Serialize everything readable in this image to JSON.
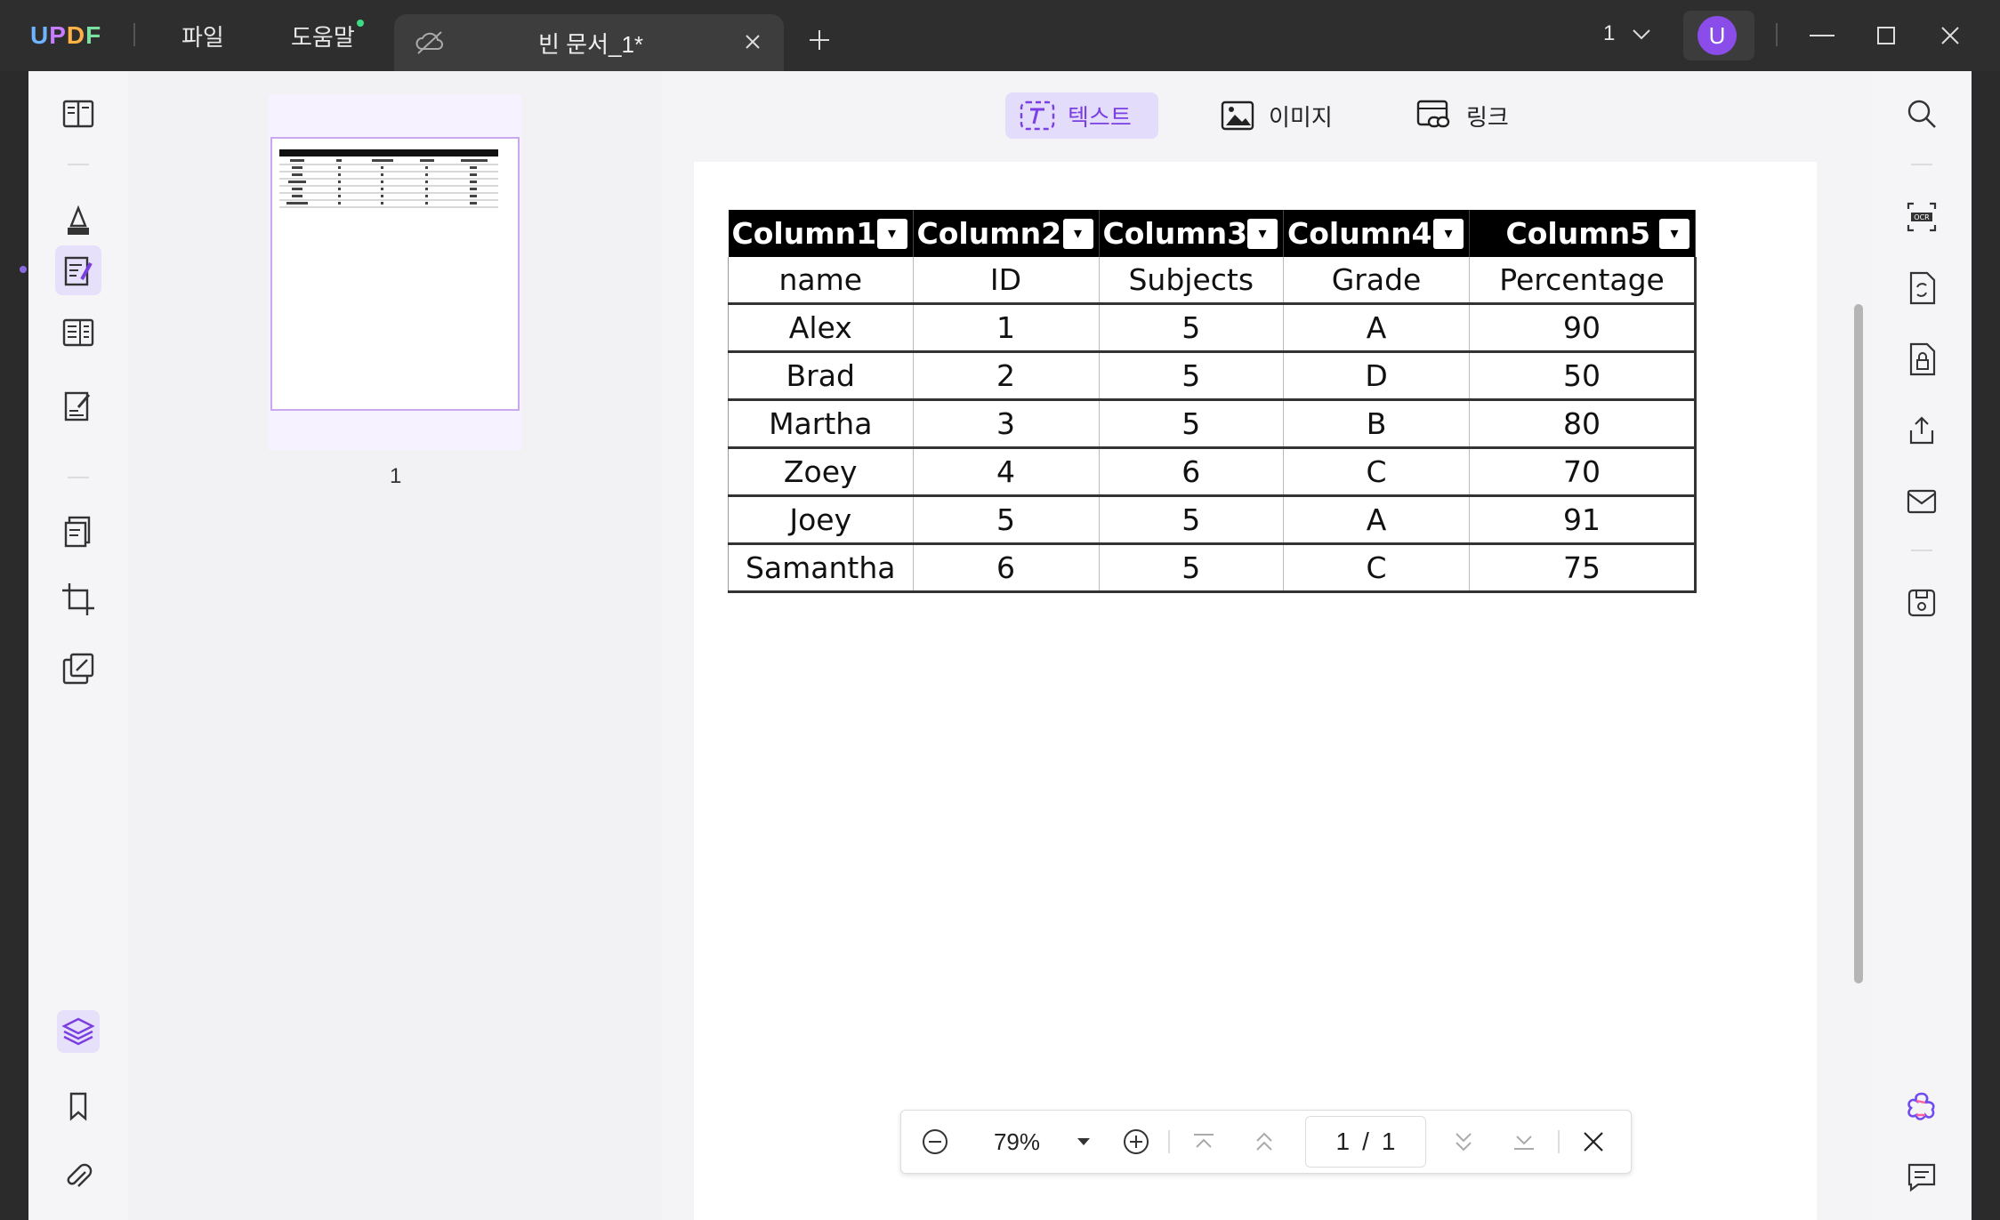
{
  "titlebar": {
    "app_logo": "UPDF",
    "menu": [
      "파일",
      "도움말"
    ],
    "tab_title": "빈 문서_1*",
    "page_selector": "1",
    "avatar_letter": "U"
  },
  "edit_toolbar": {
    "text_label": "텍스트",
    "image_label": "이미지",
    "link_label": "링크"
  },
  "thumbnail": {
    "page_number": "1"
  },
  "table": {
    "headers": [
      "Column1",
      "Column2",
      "Column3",
      "Column4",
      "Column5"
    ],
    "rows": [
      [
        "name",
        "ID",
        "Subjects",
        "Grade",
        "Percentage"
      ],
      [
        "Alex",
        "1",
        "5",
        "A",
        "90"
      ],
      [
        "Brad",
        "2",
        "5",
        "D",
        "50"
      ],
      [
        "Martha",
        "3",
        "5",
        "B",
        "80"
      ],
      [
        "Zoey",
        "4",
        "6",
        "C",
        "70"
      ],
      [
        "Joey",
        "5",
        "5",
        "A",
        "91"
      ],
      [
        "Samantha",
        "6",
        "5",
        "C",
        "75"
      ]
    ]
  },
  "zoom": {
    "level": "79%",
    "current_page": "1",
    "total_pages": "1"
  },
  "colors": {
    "accent": "#7a3fe0",
    "active_bg": "#e4dcfb",
    "titlebar": "#2e2e2e"
  }
}
